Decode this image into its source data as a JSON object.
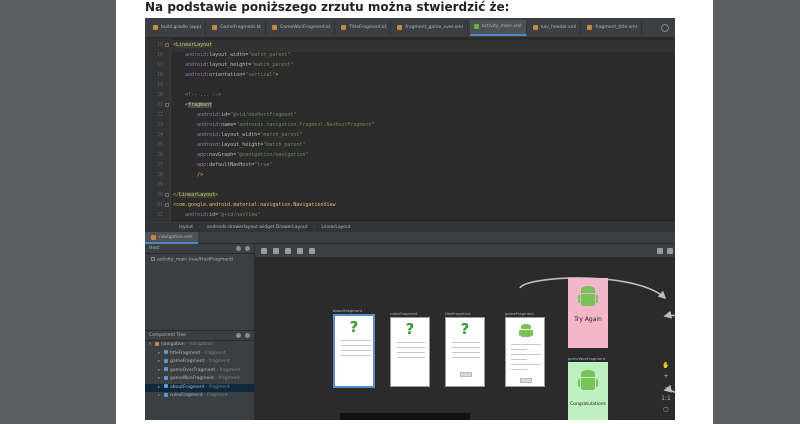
{
  "question": "Na podstawie poniższego zrzutu można stwierdzić że:",
  "tabs": [
    {
      "label": "build.gradle (app)",
      "active": false
    },
    {
      "label": "GameFragment.kt",
      "active": false
    },
    {
      "label": "GameWonFragment.kt",
      "active": false
    },
    {
      "label": "TitleFragment.kt",
      "active": false
    },
    {
      "label": "fragment_game_over.xml",
      "active": false
    },
    {
      "label": "activity_main.xml",
      "active": true
    },
    {
      "label": "nav_header.xml",
      "active": false
    },
    {
      "label": "fragment_title.xml",
      "active": false
    }
  ],
  "code_lines": [
    {
      "n": "15",
      "parts": [
        {
          "t": "<",
          "c": "t-tag"
        },
        {
          "t": "LinearLayout",
          "c": "t-tag hl-green"
        }
      ]
    },
    {
      "n": "16",
      "parts": [
        {
          "t": "    android",
          "c": "t-ns"
        },
        {
          "t": ":layout_width=",
          "c": "t-attr"
        },
        {
          "t": "\"match_parent\"",
          "c": "t-str"
        }
      ]
    },
    {
      "n": "17",
      "parts": [
        {
          "t": "    android",
          "c": "t-ns"
        },
        {
          "t": ":layout_height=",
          "c": "t-attr"
        },
        {
          "t": "\"match_parent\"",
          "c": "t-str"
        }
      ]
    },
    {
      "n": "18",
      "parts": [
        {
          "t": "    android",
          "c": "t-ns"
        },
        {
          "t": ":orientation=",
          "c": "t-attr"
        },
        {
          "t": "\"vertical\"",
          "c": "t-str"
        },
        {
          "t": ">",
          "c": "t-tag"
        }
      ]
    },
    {
      "n": "19",
      "parts": [
        {
          "t": "",
          "c": "t-attr"
        }
      ]
    },
    {
      "n": "20",
      "parts": [
        {
          "t": "    <!-- ... -->",
          "c": "t-com"
        }
      ]
    },
    {
      "n": "21",
      "parts": [
        {
          "t": "    <",
          "c": "t-tag"
        },
        {
          "t": "fragment",
          "c": "t-tag hl-tag"
        }
      ]
    },
    {
      "n": "22",
      "parts": [
        {
          "t": "        android",
          "c": "t-ns"
        },
        {
          "t": ":id=",
          "c": "t-attr"
        },
        {
          "t": "\"@+id/navHostFragment\"",
          "c": "t-str"
        }
      ]
    },
    {
      "n": "23",
      "parts": [
        {
          "t": "        android",
          "c": "t-ns"
        },
        {
          "t": ":name=",
          "c": "t-attr"
        },
        {
          "t": "\"androidx.navigation.fragment.NavHostFragment\"",
          "c": "t-str"
        }
      ]
    },
    {
      "n": "24",
      "parts": [
        {
          "t": "        android",
          "c": "t-ns"
        },
        {
          "t": ":layout_width=",
          "c": "t-attr"
        },
        {
          "t": "\"match_parent\"",
          "c": "t-str"
        }
      ]
    },
    {
      "n": "25",
      "parts": [
        {
          "t": "        android",
          "c": "t-ns"
        },
        {
          "t": ":layout_height=",
          "c": "t-attr"
        },
        {
          "t": "\"match_parent\"",
          "c": "t-str"
        }
      ]
    },
    {
      "n": "26",
      "parts": [
        {
          "t": "        app",
          "c": "t-ns"
        },
        {
          "t": ":navGraph=",
          "c": "t-attr"
        },
        {
          "t": "\"@navigation/navigation\"",
          "c": "t-str"
        }
      ]
    },
    {
      "n": "27",
      "parts": [
        {
          "t": "        app",
          "c": "t-ns"
        },
        {
          "t": ":defaultNavHost=",
          "c": "t-attr"
        },
        {
          "t": "\"true\"",
          "c": "t-str"
        }
      ]
    },
    {
      "n": "28",
      "parts": [
        {
          "t": "        />",
          "c": "t-tag"
        }
      ]
    },
    {
      "n": "29",
      "parts": [
        {
          "t": "",
          "c": "t-attr"
        }
      ]
    },
    {
      "n": "30",
      "parts": [
        {
          "t": "</",
          "c": "t-tag"
        },
        {
          "t": "LinearLayout",
          "c": "t-tag hl-green"
        },
        {
          "t": ">",
          "c": "t-tag"
        }
      ]
    },
    {
      "n": "31",
      "parts": [
        {
          "t": "<com.google.android.material.navigation.NavigationView",
          "c": "t-tag"
        }
      ]
    },
    {
      "n": "32",
      "parts": [
        {
          "t": "    android",
          "c": "t-ns"
        },
        {
          "t": ":id=",
          "c": "t-attr"
        },
        {
          "t": "\"@+id/navView\"",
          "c": "t-str"
        }
      ]
    }
  ],
  "breadcrumb": [
    "layout",
    "androidx.drawerlayout.widget.DrawerLayout",
    "LinearLayout"
  ],
  "design_tab": "navigation.xml",
  "host_panel": {
    "title": "Host",
    "item": "activity_main (nav/HostFragment)"
  },
  "tree_panel": {
    "title": "Component Tree",
    "items": [
      {
        "name": "navigation",
        "sub": "- navigation",
        "level": 0,
        "root": true,
        "selected": false
      },
      {
        "name": "titleFragment",
        "sub": "- fragment",
        "level": 1,
        "root": false,
        "selected": false
      },
      {
        "name": "gameFragment",
        "sub": "- fragment",
        "level": 1,
        "root": false,
        "selected": false
      },
      {
        "name": "gameOverFragment",
        "sub": "- fragment",
        "level": 1,
        "root": false,
        "selected": false
      },
      {
        "name": "gameWonFragment",
        "sub": "- fragment",
        "level": 1,
        "root": false,
        "selected": false
      },
      {
        "name": "aboutFragment",
        "sub": "- fragment",
        "level": 1,
        "root": false,
        "selected": true
      },
      {
        "name": "rulesFragment",
        "sub": "- fragment",
        "level": 1,
        "root": false,
        "selected": false
      }
    ]
  },
  "graph": {
    "fragments": [
      {
        "label": "aboutFragment",
        "kind": "question"
      },
      {
        "label": "rulesFragment",
        "kind": "question"
      },
      {
        "label": "titleFragment",
        "kind": "question"
      },
      {
        "label": "gameFragment",
        "kind": "game"
      },
      {
        "label": "",
        "kind": "lost",
        "big_text": "Try Again"
      },
      {
        "label": "gameWonFragment",
        "kind": "won",
        "big_text": "Congratulations"
      }
    ],
    "colors": {
      "lost_bg": "#f4b6c8",
      "won_bg": "#bff0bf",
      "android_green": "#78c257",
      "arrow": "#bdbdbd"
    }
  },
  "zoom": [
    "+",
    "-",
    "1:1"
  ]
}
